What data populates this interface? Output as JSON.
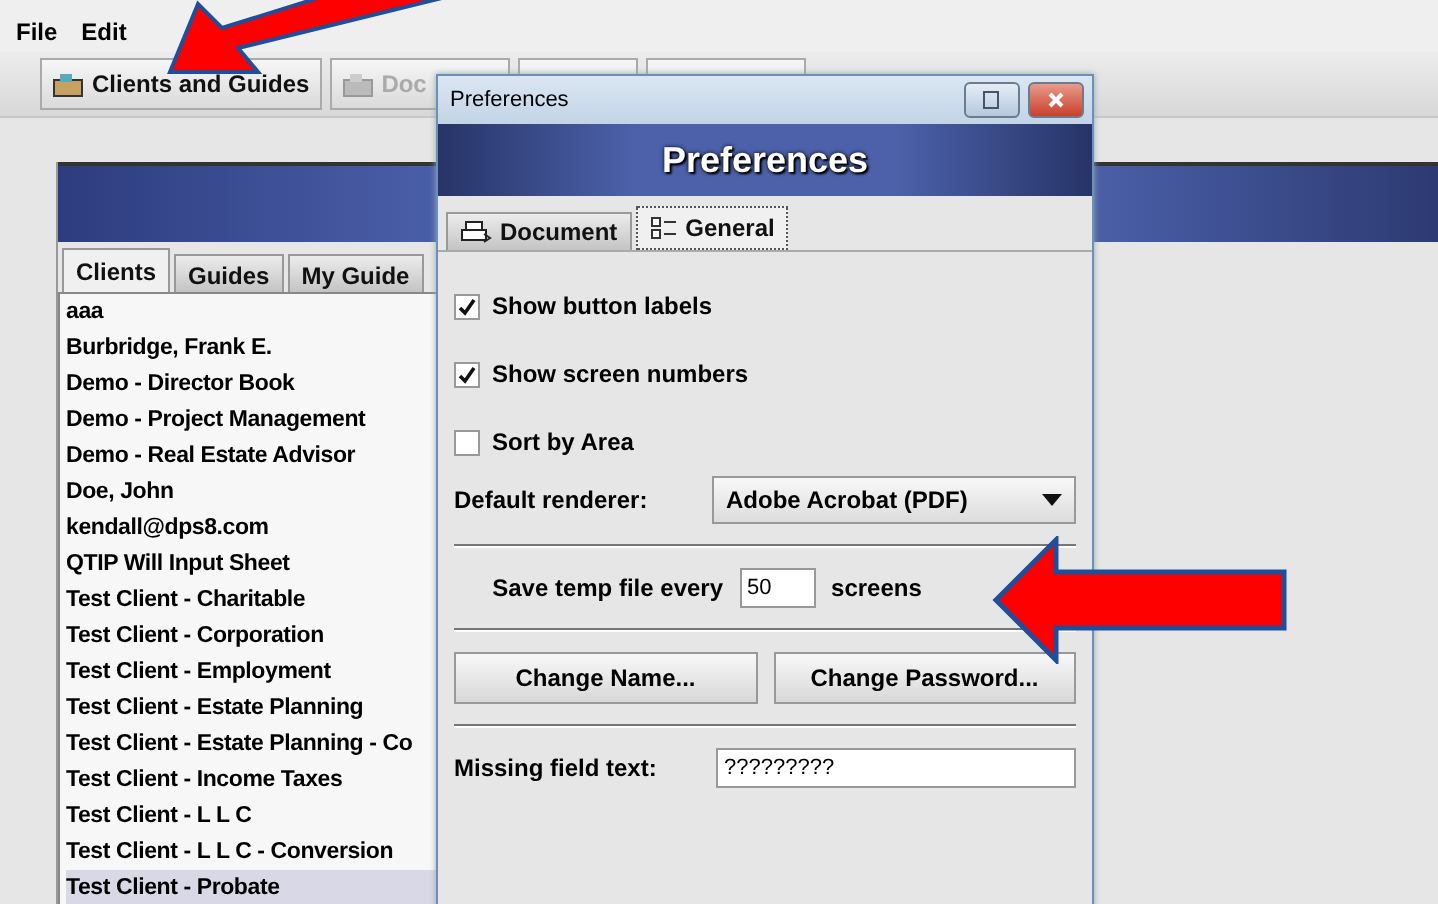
{
  "menu": [
    "File",
    "Edit"
  ],
  "toolbar": [
    {
      "label": "Clients and Guides",
      "disabled": false
    },
    {
      "label": "Doc",
      "disabled": true
    }
  ],
  "main": {
    "tabs": [
      {
        "label": "Clients",
        "selected": true
      },
      {
        "label": "Guides",
        "selected": false
      },
      {
        "label": "My Guide",
        "selected": false
      }
    ],
    "clients": [
      {
        "name": "aaa",
        "selected": false
      },
      {
        "name": "Burbridge, Frank E.",
        "selected": false
      },
      {
        "name": "Demo - Director Book",
        "selected": false
      },
      {
        "name": "Demo - Project Management",
        "selected": false
      },
      {
        "name": "Demo - Real Estate Advisor",
        "selected": false
      },
      {
        "name": "Doe, John",
        "selected": false
      },
      {
        "name": "kendall@dps8.com",
        "selected": false
      },
      {
        "name": "QTIP Will Input Sheet",
        "selected": false
      },
      {
        "name": "Test Client - Charitable",
        "selected": false
      },
      {
        "name": "Test Client - Corporation",
        "selected": false
      },
      {
        "name": "Test Client - Employment",
        "selected": false
      },
      {
        "name": "Test Client - Estate Planning",
        "selected": false
      },
      {
        "name": "Test Client - Estate Planning - Co",
        "selected": false
      },
      {
        "name": "Test Client - Income Taxes",
        "selected": false
      },
      {
        "name": "Test Client - L L C",
        "selected": false
      },
      {
        "name": "Test Client - L L C - Conversion",
        "selected": false
      },
      {
        "name": "Test Client - Probate",
        "selected": true
      }
    ]
  },
  "dialog": {
    "title": "Preferences",
    "banner": "Preferences",
    "tabs": [
      {
        "label": "Document",
        "selected": false
      },
      {
        "label": "General",
        "selected": true
      }
    ],
    "options": [
      {
        "label": "Show button labels",
        "checked": true
      },
      {
        "label": "Show screen numbers",
        "checked": true
      },
      {
        "label": "Sort by Area",
        "checked": false
      }
    ],
    "renderer": {
      "label": "Default renderer:",
      "value": "Adobe Acrobat (PDF)"
    },
    "temp": {
      "before": "Save temp file every",
      "value": "50",
      "after": "screens"
    },
    "buttons": [
      "Change Name...",
      "Change Password..."
    ],
    "missing": {
      "label": "Missing field text:",
      "value": "?????????"
    }
  }
}
